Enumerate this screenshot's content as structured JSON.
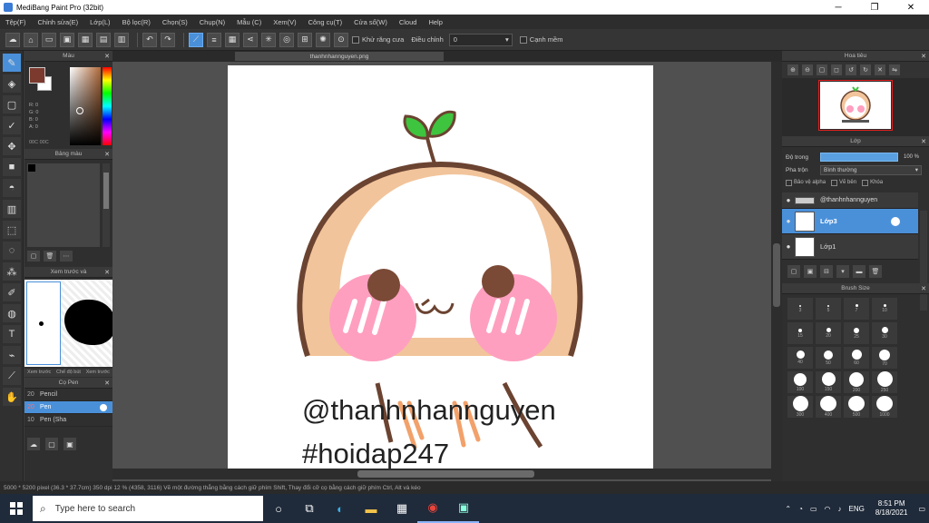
{
  "window": {
    "title": "MediBang Paint Pro (32bit)",
    "controls": [
      "─",
      "❐",
      "✕"
    ]
  },
  "menu": [
    "Tệp(F)",
    "Chỉnh sửa(E)",
    "Lớp(L)",
    "Bộ lọc(R)",
    "Chọn(S)",
    "Chụp(N)",
    "Mẫu (C)",
    "Xem(V)",
    "Công cụ(T)",
    "Cửa sổ(W)",
    "Cloud",
    "Help"
  ],
  "toolbar": {
    "checkbox_label": "Khử răng cưa",
    "adjust_label": "Điều chỉnh",
    "adjust_value": "0",
    "right_label": "Cạnh mềm"
  },
  "panels": {
    "color": {
      "title": "Màu",
      "info": [
        "R: 0",
        "G: 0",
        "B: 0",
        "A: 0"
      ],
      "hex": "00C 00C"
    },
    "palette": {
      "title": "Bảng màu"
    },
    "navigator_small": {
      "title": "Xem trước và",
      "tabs": [
        "Xem trước và",
        "Chế độ bút",
        "Xem trước và"
      ]
    },
    "brush": {
      "title": "Cọ Pen",
      "items": [
        {
          "num": "20",
          "name": "Pencil"
        },
        {
          "num": "20",
          "name": "Pen"
        },
        {
          "num": "10",
          "name": "Pen (Sha"
        }
      ]
    },
    "navigator": {
      "title": "Hoa tiêu"
    },
    "layer": {
      "title": "Lớp",
      "opacity_label": "Độ trong",
      "opacity_value": "100 %",
      "blend_label": "Pha trộn",
      "blend_value": "Bình thường",
      "checks": [
        "Bảo vệ alpha",
        "Vẽ bên",
        "Khóa"
      ],
      "layers": [
        {
          "name": "@thanhnhannguyen"
        },
        {
          "name": "Lớp3"
        },
        {
          "name": "Lớp1"
        }
      ]
    },
    "brush_size": {
      "title": "Brush Size",
      "labels": [
        "3",
        "5",
        "7",
        "10",
        "15",
        "20",
        "25",
        "30",
        "40",
        "50",
        "60",
        "70",
        "100",
        "150",
        "200",
        "250",
        "300",
        "400",
        "500",
        "1000"
      ]
    }
  },
  "document": {
    "tab_name": "thanhnhannguyen.png",
    "text_line1": "@thanhnhannguyen",
    "text_line2": "#hoidap247"
  },
  "status": "5000 * 5200 pixel   (36.3 * 37.7cm)   350 dpi   12 %   (4358, 3116)   Vẽ một đường thẳng bằng cách giữ phím Shift, Thay đổi cỡ cọ bằng cách giữ phím Ctrl, Alt và kéo",
  "taskbar": {
    "search_placeholder": "Type here to search",
    "lang": "ENG",
    "time": "8:51 PM",
    "date": "8/18/2021"
  },
  "colors": {
    "accent": "#4a90d9",
    "sprout": "#3ec43e",
    "outline": "#6b4331",
    "skin": "#f2c49b",
    "blush": "#ff9fc0"
  }
}
